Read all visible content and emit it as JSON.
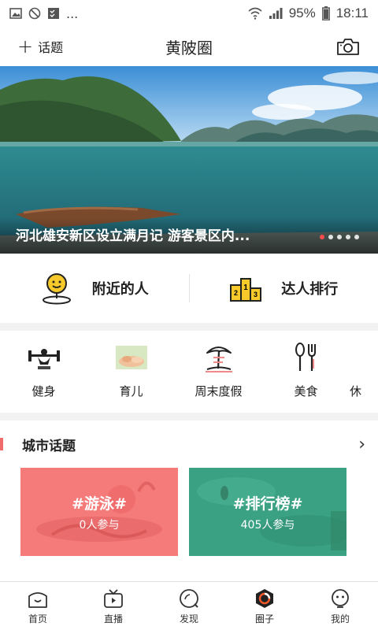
{
  "status_bar": {
    "signal_percent": "95%",
    "time": "18:11",
    "more": "..."
  },
  "header": {
    "add_topic_label": "话题",
    "title": "黄陂圈"
  },
  "banner": {
    "caption": "河北雄安新区设立满月记 游客景区内...",
    "slide_count": 5,
    "active_slide": 1
  },
  "quick_links": [
    {
      "label": "附近的人",
      "icon": "smiley-location-icon"
    },
    {
      "label": "达人排行",
      "icon": "podium-icon"
    }
  ],
  "categories": [
    {
      "label": "健身",
      "icon": "fitness-icon"
    },
    {
      "label": "育儿",
      "icon": "parenting-icon"
    },
    {
      "label": "周末度假",
      "icon": "palm-tree-icon"
    },
    {
      "label": "美食",
      "icon": "spoon-fork-icon"
    },
    {
      "label": "休"
    }
  ],
  "city_topics": {
    "title": "城市话题",
    "cards": [
      {
        "name": "#游泳#",
        "count": "0人参与",
        "color": "#f57b7b"
      },
      {
        "name": "#排行榜#",
        "count": "405人参与",
        "color": "#3fa283"
      }
    ]
  },
  "tabs": [
    {
      "label": "首页",
      "icon": "home-icon"
    },
    {
      "label": "直播",
      "icon": "tv-icon"
    },
    {
      "label": "发现",
      "icon": "discover-icon"
    },
    {
      "label": "圈子",
      "icon": "circle-icon",
      "active": true
    },
    {
      "label": "我的",
      "icon": "profile-icon"
    }
  ],
  "colors": {
    "accent": "#f26b6b",
    "active_tab": "#f5592e"
  }
}
